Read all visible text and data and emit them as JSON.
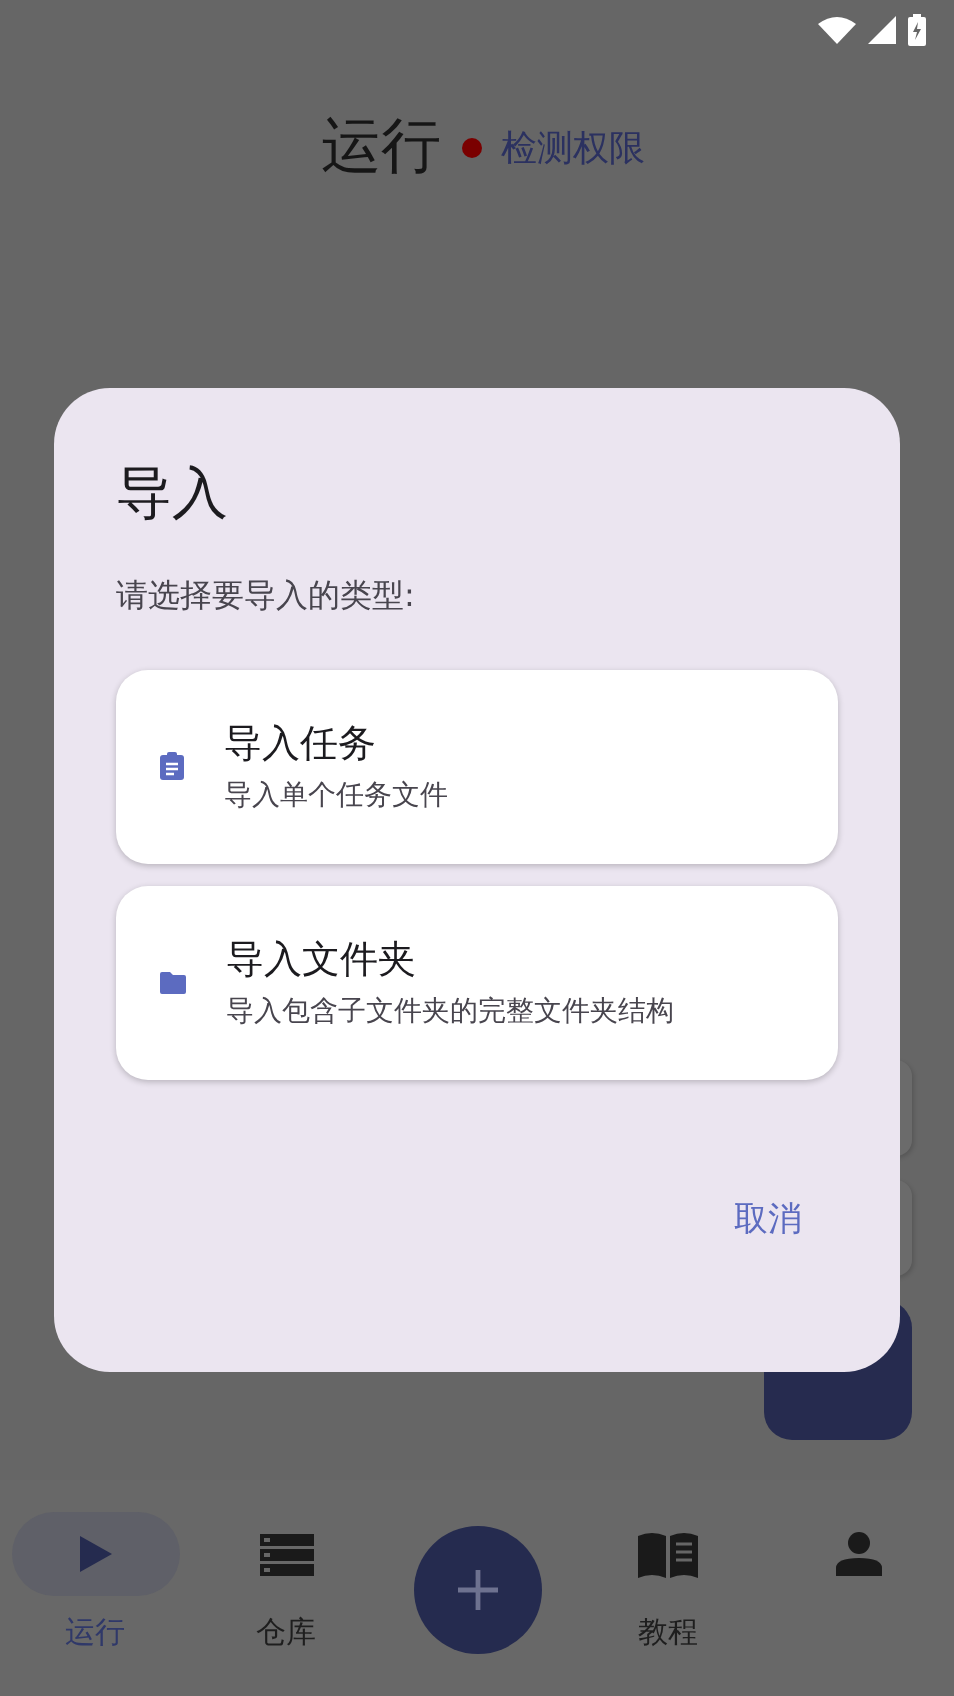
{
  "header": {
    "title": "运行",
    "permission_link": "检测权限"
  },
  "dialog": {
    "title": "导入",
    "prompt": "请选择要导入的类型:",
    "options": [
      {
        "kind": "task",
        "title": "导入任务",
        "description": "导入单个任务文件"
      },
      {
        "kind": "folder",
        "title": "导入文件夹",
        "description": "导入包含子文件夹的完整文件夹结构"
      }
    ],
    "cancel": "取消"
  },
  "nav": {
    "items": [
      {
        "kind": "run",
        "label": "运行",
        "selected": true
      },
      {
        "kind": "storage",
        "label": "仓库",
        "selected": false
      },
      {
        "kind": "add",
        "selected": false
      },
      {
        "kind": "tutorial",
        "label": "教程",
        "selected": false
      },
      {
        "kind": "profile",
        "selected": false
      }
    ]
  }
}
